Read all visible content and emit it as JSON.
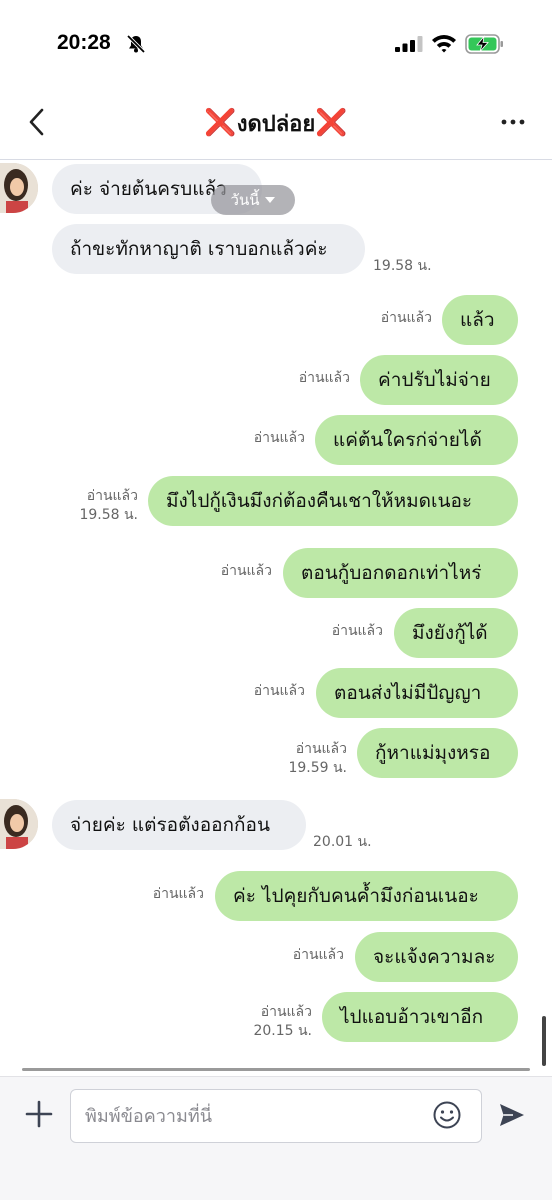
{
  "status_bar": {
    "time": "20:28"
  },
  "header": {
    "title_mark_left": "❌",
    "title_text": "งดปล่อย",
    "title_mark_right": "❌"
  },
  "chat": {
    "date_chip": "วันนี้",
    "messages": [
      {
        "side": "in",
        "text": "ค่ะ จ่ายต้นครบแล้ว"
      },
      {
        "side": "in",
        "text": "ถ้าขะทักหาญาติ เราบอกแล้วค่ะ",
        "time": "19.58 น."
      },
      {
        "side": "out",
        "text": "แล้ว",
        "read": "อ่านแล้ว"
      },
      {
        "side": "out",
        "text": "ค่าปรับไม่จ่าย",
        "read": "อ่านแล้ว"
      },
      {
        "side": "out",
        "text": "แค่ต้นใครก่จ่ายได้",
        "read": "อ่านแล้ว"
      },
      {
        "side": "out",
        "text": "มึงไปกู้เงินมึงก่ต้องคืนเชาให้หมดเนอะ",
        "read": "อ่านแล้ว",
        "time": "19.58 น."
      },
      {
        "side": "out",
        "text": "ตอนกู้บอกดอกเท่าไหร่",
        "read": "อ่านแล้ว"
      },
      {
        "side": "out",
        "text": "มึงยังกู้ได้",
        "read": "อ่านแล้ว"
      },
      {
        "side": "out",
        "text": "ตอนส่งไม่มีปัญญา",
        "read": "อ่านแล้ว"
      },
      {
        "side": "out",
        "text": "กู้หาแม่มุงหรอ",
        "read": "อ่านแล้ว",
        "time": "19.59 น."
      },
      {
        "side": "in",
        "text": "จ่ายค่ะ แต่รอตังออกก้อน",
        "time": "20.01 น."
      },
      {
        "side": "out",
        "text": "ค่ะ ไปคุยกับคนค้ำมึงก่อนเนอะ",
        "read": "อ่านแล้ว"
      },
      {
        "side": "out",
        "text": "จะแจ้งความละ",
        "read": "อ่านแล้ว"
      },
      {
        "side": "out",
        "text": "ไปแอบอ้าวเขาอีก",
        "read": "อ่านแล้ว",
        "time": "20.15 น."
      }
    ]
  },
  "input": {
    "placeholder": "พิมพ์ข้อความที่นี่"
  },
  "icons": {
    "back": "chevron-left-icon",
    "more": "more-horizontal-icon",
    "plus": "plus-icon",
    "emoji": "smiley-icon",
    "send": "send-arrow-icon",
    "bell_muted": "bell-slash-icon",
    "signal": "cellular-signal-icon",
    "wifi": "wifi-icon",
    "battery": "battery-charging-icon"
  },
  "colors": {
    "outgoing_bubble": "#bde8a7",
    "incoming_bubble": "#eceef2",
    "title_mark": "#e0201b",
    "battery_fill": "#34c759"
  }
}
